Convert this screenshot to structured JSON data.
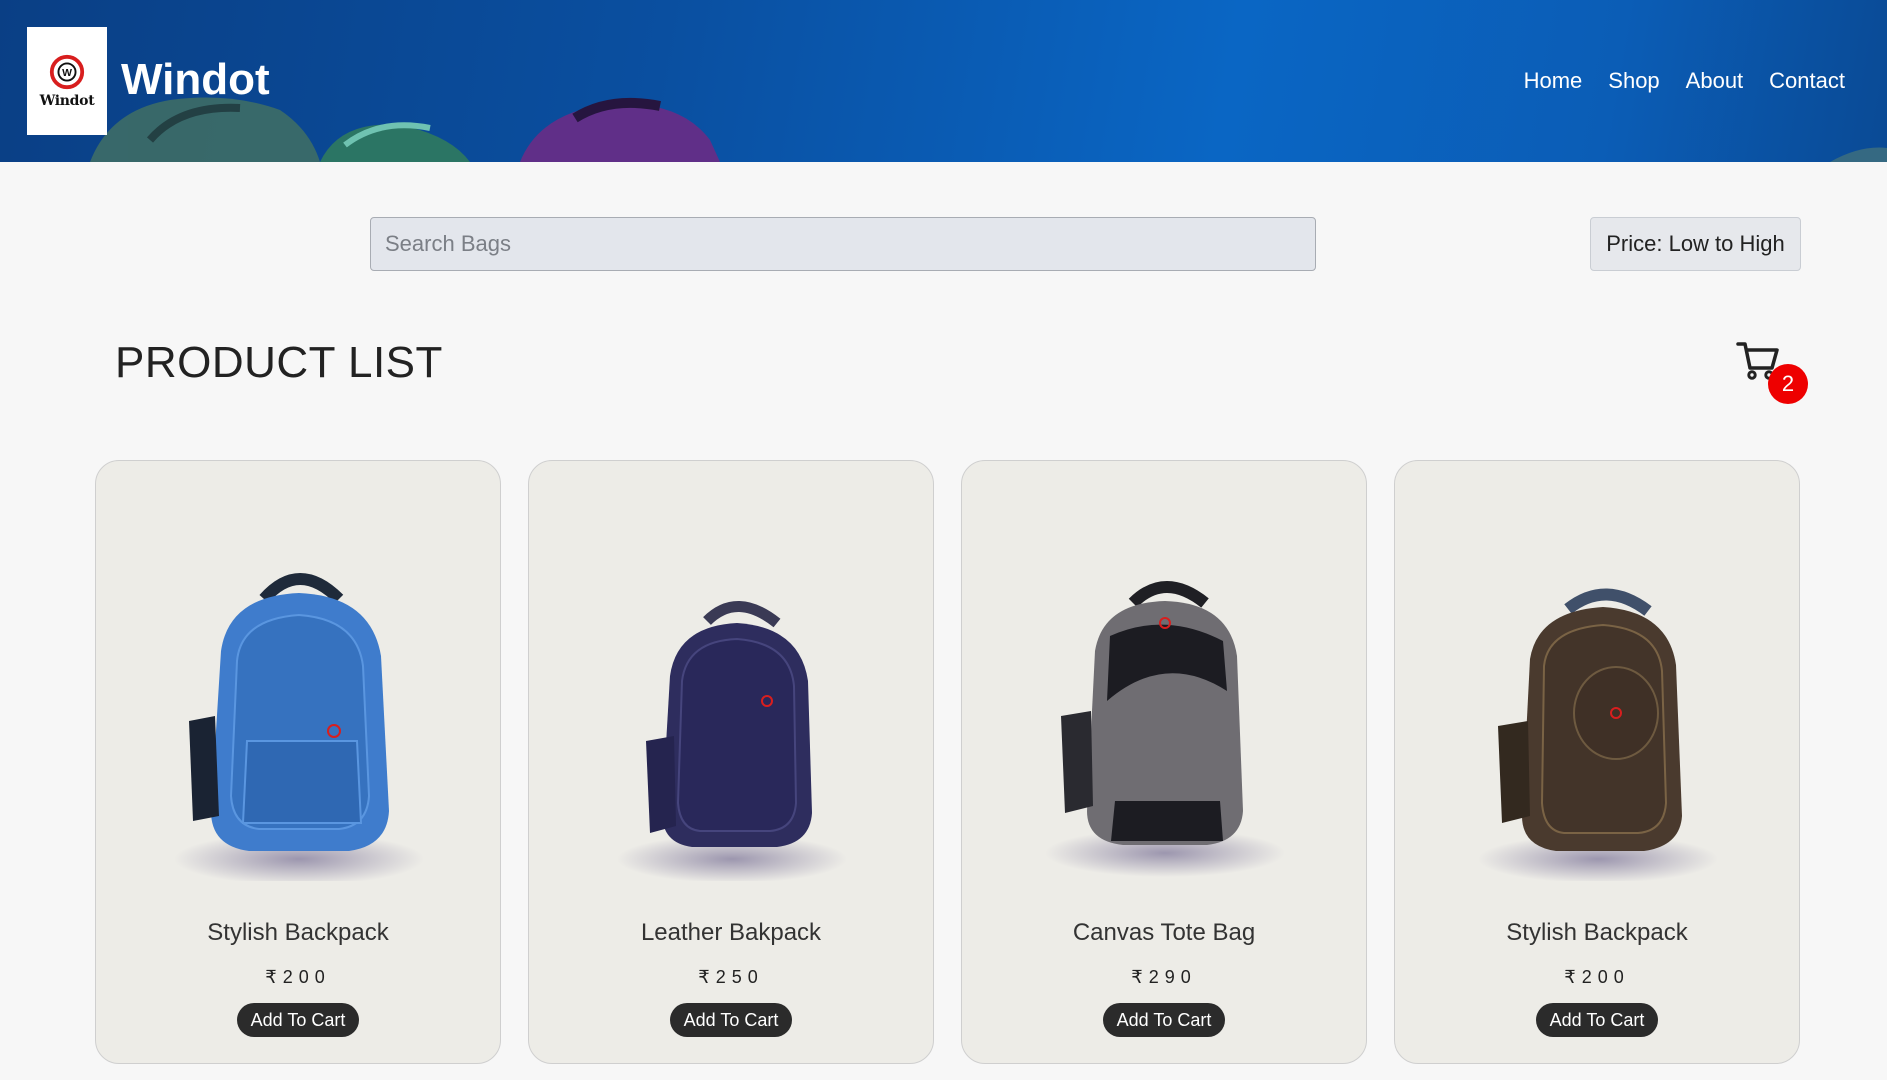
{
  "header": {
    "brand": "Windot",
    "logo_text": "Windot",
    "nav": [
      "Home",
      "Shop",
      "About",
      "Contact"
    ]
  },
  "search": {
    "placeholder": "Search Bags",
    "value": ""
  },
  "sort": {
    "label": "Price: Low to High"
  },
  "page_title": "PRODUCT LIST",
  "cart": {
    "count": "2",
    "icon": "cart-icon"
  },
  "products": [
    {
      "name": "Stylish Backpack",
      "price": "₹200",
      "button": "Add To Cart",
      "color": "#3f7ccc"
    },
    {
      "name": "Leather Bakpack",
      "price": "₹250",
      "button": "Add To Cart",
      "color": "#2e2d5e"
    },
    {
      "name": "Canvas Tote Bag",
      "price": "₹290",
      "button": "Add To Cart",
      "color": "#6f6d72"
    },
    {
      "name": "Stylish Backpack",
      "price": "₹200",
      "button": "Add To Cart",
      "color": "#4a3a2e"
    }
  ],
  "colors": {
    "header": "#0a56a8",
    "badge": "#ee0000",
    "button": "#2b2b2b"
  }
}
